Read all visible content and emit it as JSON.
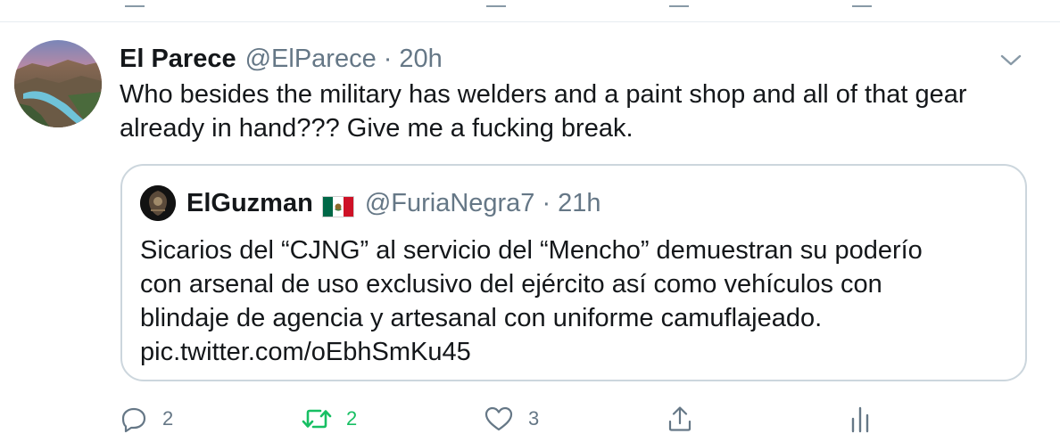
{
  "tweet": {
    "author_name": "El Parece",
    "author_handle": "@ElParece",
    "separator": "·",
    "time": "20h",
    "text": "Who besides the military has welders and a paint shop and all of that gear already in hand??? Give me a fucking break."
  },
  "quoted_tweet": {
    "author_name": "ElGuzman",
    "author_flag": "mexico-flag-icon",
    "author_handle": "@FuriaNegra7",
    "separator": "·",
    "time": "21h",
    "text_lines": [
      "Sicarios del “CJNG” al servicio del “Mencho” demuestran su poderío",
      "con arsenal de uso exclusivo del ejército así como vehículos con",
      "blindaje de agencia y artesanal con uniforme camuflajeado.",
      "pic.twitter.com/oEbhSmKu45"
    ]
  },
  "actions": {
    "reply_count": "2",
    "retweet_count": "2",
    "like_count": "3"
  },
  "icons": {
    "reply": "reply-icon",
    "retweet": "retweet-icon",
    "like": "like-icon",
    "share": "share-icon",
    "analytics": "analytics-icon",
    "caret": "chevron-down-icon"
  },
  "colors": {
    "text_primary": "#14171a",
    "text_secondary": "#657786",
    "retweet_active": "#17bf63",
    "border": "#ccd6dd"
  }
}
